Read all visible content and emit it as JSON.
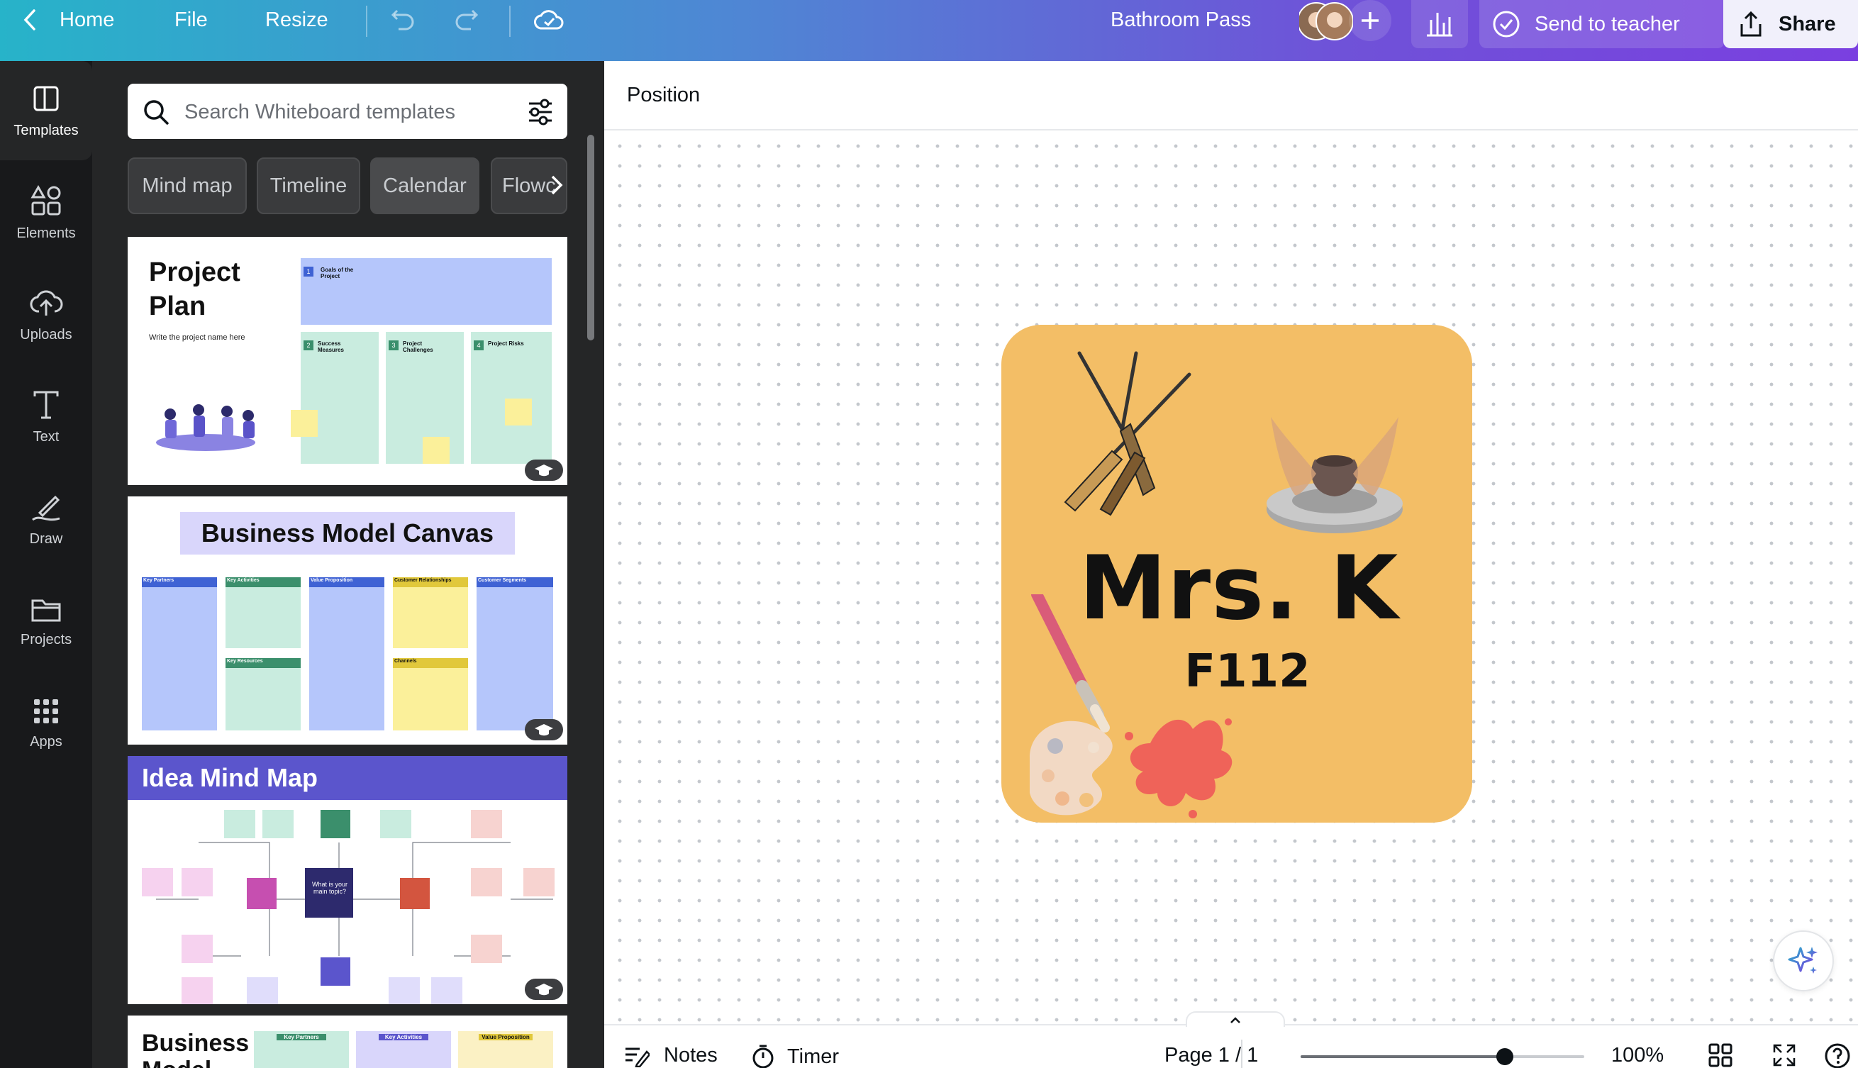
{
  "topbar": {
    "home_label": "Home",
    "file_label": "File",
    "resize_label": "Resize",
    "design_title": "Bathroom Pass",
    "send_label": "Send to teacher",
    "share_label": "Share",
    "gradient_colors": [
      "#27b3c9",
      "#6f52d8",
      "#7a3fe0"
    ]
  },
  "rail": {
    "items": [
      {
        "label": "Templates",
        "icon": "templates-icon",
        "active": true
      },
      {
        "label": "Elements",
        "icon": "elements-icon"
      },
      {
        "label": "Uploads",
        "icon": "uploads-icon"
      },
      {
        "label": "Text",
        "icon": "text-icon"
      },
      {
        "label": "Draw",
        "icon": "draw-icon"
      },
      {
        "label": "Projects",
        "icon": "projects-icon"
      },
      {
        "label": "Apps",
        "icon": "apps-icon"
      }
    ]
  },
  "panel": {
    "search_placeholder": "Search Whiteboard templates",
    "chips": [
      "Mind map",
      "Timeline",
      "Calendar",
      "Flowc"
    ],
    "templates": {
      "project_plan": {
        "title": "Project Plan",
        "subtitle": "Write the project name here",
        "boxes": [
          {
            "num": "1",
            "title": "Goals of the Project"
          },
          {
            "num": "2",
            "title": "Success Measures"
          },
          {
            "num": "3",
            "title": "Project Challenges"
          },
          {
            "num": "4",
            "title": "Project Risks"
          }
        ]
      },
      "business_model_canvas": {
        "title": "Business Model Canvas",
        "columns": [
          "Key Partners",
          "Key Activities",
          "Value Proposition",
          "Customer Relationships",
          "Customer Segments"
        ],
        "sub_boxes": [
          "Key Resources",
          "Channels"
        ]
      },
      "idea_mind_map": {
        "title": "Idea Mind Map",
        "center": "What is your main topic?"
      },
      "business_model_2": {
        "title": "Business Model",
        "columns": [
          "Key Partners",
          "Key Activities",
          "Value Proposition"
        ]
      }
    }
  },
  "editor": {
    "position_label": "Position",
    "pass_name": "Mrs. K",
    "pass_room": "F112",
    "pass_color": "#f3be66"
  },
  "bottom": {
    "notes_label": "Notes",
    "timer_label": "Timer",
    "page_label": "Page 1 / 1",
    "zoom_label": "100%",
    "zoom_fraction": 0.72
  }
}
